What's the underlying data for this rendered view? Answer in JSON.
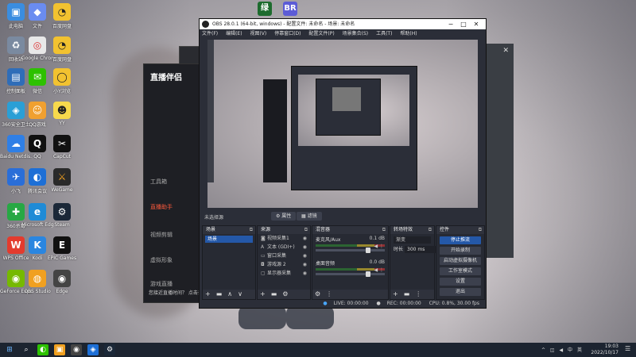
{
  "desktop_icons_col1": [
    "此电脑",
    "回收站",
    "控制面板",
    "360安全卫士",
    "Baidu Netdis...",
    "小飞",
    "360杀毒",
    "WPS Office",
    "GeForce Experience"
  ],
  "desktop_icons_col2": [
    "文件",
    "Google Chrome",
    "微信",
    "QQ游戏",
    "QQ",
    "腾讯会议",
    "Microsoft Edge",
    "Kodi",
    "OBS Studio"
  ],
  "desktop_icons_col3": [
    "百度网盘",
    "百度网盘",
    "小Y浏览",
    "YY",
    "CapCut",
    "WeGame",
    "Steam",
    "TIM",
    "EPIC Games",
    "Edge"
  ],
  "top_apps": [
    "绿",
    "BR"
  ],
  "bg_app": {
    "brand": "直播伴侣",
    "items": [
      "工具箱",
      "直播助手",
      "视频剪辑",
      "虚拟形象",
      "游戏直播"
    ],
    "notice": "您接近直播时间？ 点击去"
  },
  "obs": {
    "title": "OBS 28.0.1 (64-bit, windows) - 配置文件: 未命名 - 场景: 未命名",
    "menu": [
      "文件(F)",
      "编辑(E)",
      "视图(V)",
      "停靠窗口(D)",
      "配置文件(P)",
      "场景集合(S)",
      "工具(T)",
      "帮助(H)"
    ],
    "no_source": "未选择源",
    "props_btn": "属性",
    "filters_btn": "滤镜",
    "docks": {
      "scenes": "场景",
      "sources": "来源",
      "mixer": "混音器",
      "transitions": "转场特效",
      "controls": "控件"
    },
    "scenes": [
      "场景"
    ],
    "sources": [
      {
        "icon": "camera-icon",
        "name": "视频采集1"
      },
      {
        "icon": "text-icon",
        "name": "文本 (GDI+)"
      },
      {
        "icon": "window-icon",
        "name": "窗口采集"
      },
      {
        "icon": "gamepad-icon",
        "name": "游戏源 2"
      },
      {
        "icon": "monitor-icon",
        "name": "显示器采集"
      }
    ],
    "mixer": [
      {
        "name": "麦克风/Aux",
        "db": "0.1 dB"
      },
      {
        "name": "桌面音频",
        "db": "0.0 dB"
      }
    ],
    "transition": {
      "type": "渐变",
      "duration_label": "时长",
      "duration": "300 ms"
    },
    "controls": [
      "停止推流",
      "开始录制",
      "启动虚拟摄像机",
      "工作室模式",
      "设置",
      "退出"
    ],
    "status": {
      "live": "LIVE: 00:00:00",
      "rec": "REC: 00:00:00",
      "cpu": "CPU: 0.8%, 30.00 fps"
    }
  },
  "taskbar": {
    "time": "19:03",
    "date": "2022/10/17",
    "tray": [
      "^",
      "中",
      "英"
    ]
  }
}
